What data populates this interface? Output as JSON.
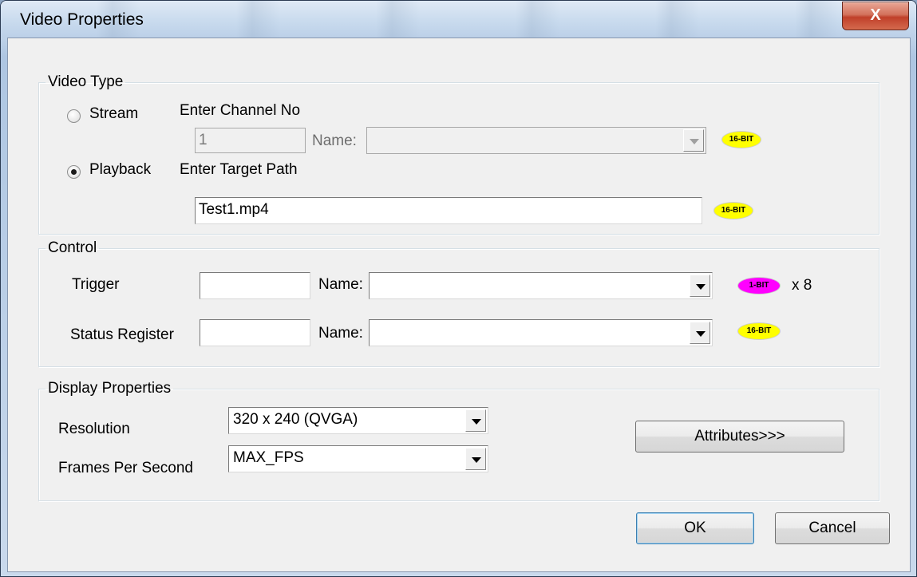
{
  "window": {
    "title": "Video Properties",
    "close_label": "X"
  },
  "video_type": {
    "legend": "Video Type",
    "stream_label": "Stream",
    "playback_label": "Playback",
    "selected": "Playback",
    "channel_heading": "Enter Channel No",
    "channel_value": "1",
    "channel_name_label": "Name:",
    "channel_name_value": "",
    "channel_badge": "16-BIT",
    "target_heading": "Enter Target Path",
    "target_value": "Test1.mp4",
    "target_badge": "16-BIT"
  },
  "control": {
    "legend": "Control",
    "trigger_label": "Trigger",
    "trigger_value": "",
    "trigger_name_label": "Name:",
    "trigger_name_value": "",
    "trigger_badge": "1-BIT",
    "trigger_multiplier": "x 8",
    "status_label": "Status Register",
    "status_value": "",
    "status_name_label": "Name:",
    "status_name_value": "",
    "status_badge": "16-BIT"
  },
  "display": {
    "legend": "Display Properties",
    "resolution_label": "Resolution",
    "resolution_value": "320 x 240 (QVGA)",
    "fps_label": "Frames Per Second",
    "fps_value": "MAX_FPS",
    "attributes_label": "Attributes>>>"
  },
  "footer": {
    "ok_label": "OK",
    "cancel_label": "Cancel"
  },
  "colors": {
    "badge_16bit": "#ffff00",
    "badge_1bit": "#ff00ff",
    "close_button": "#c7452f"
  }
}
